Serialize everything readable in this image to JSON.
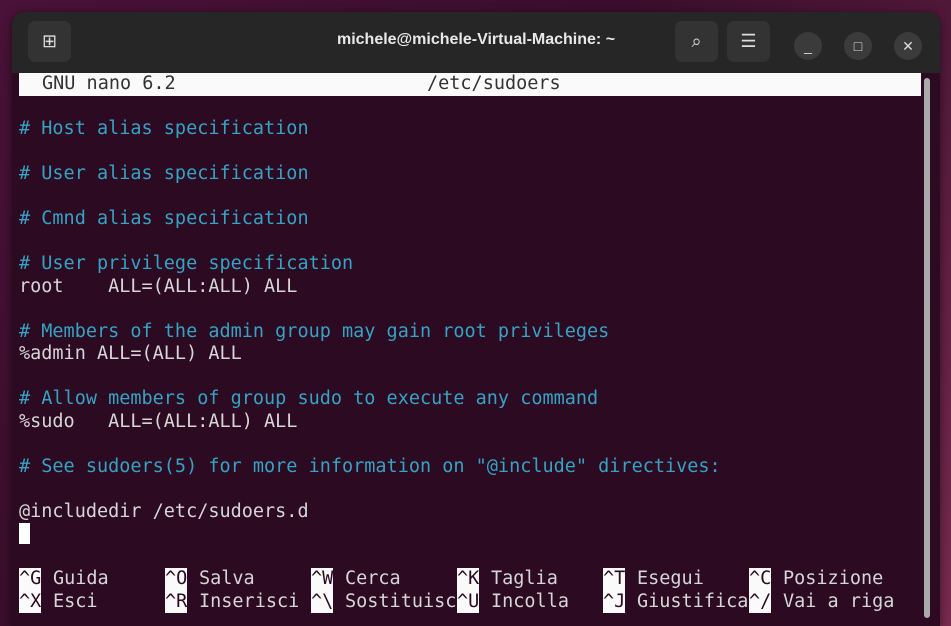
{
  "window": {
    "title": "michele@michele-Virtual-Machine: ~"
  },
  "nano": {
    "version": "GNU nano 6.2",
    "file": "/etc/sudoers"
  },
  "lines": [
    {
      "text": "",
      "type": "text"
    },
    {
      "text": "# Host alias specification",
      "type": "comment"
    },
    {
      "text": "",
      "type": "text"
    },
    {
      "text": "# User alias specification",
      "type": "comment"
    },
    {
      "text": "",
      "type": "text"
    },
    {
      "text": "# Cmnd alias specification",
      "type": "comment"
    },
    {
      "text": "",
      "type": "text"
    },
    {
      "text": "# User privilege specification",
      "type": "comment"
    },
    {
      "text": "root    ALL=(ALL:ALL) ALL",
      "type": "text"
    },
    {
      "text": "",
      "type": "text"
    },
    {
      "text": "# Members of the admin group may gain root privileges",
      "type": "comment"
    },
    {
      "text": "%admin ALL=(ALL) ALL",
      "type": "text"
    },
    {
      "text": "",
      "type": "text"
    },
    {
      "text": "# Allow members of group sudo to execute any command",
      "type": "comment"
    },
    {
      "text": "%sudo   ALL=(ALL:ALL) ALL",
      "type": "text"
    },
    {
      "text": "",
      "type": "text"
    },
    {
      "text": "# See sudoers(5) for more information on \"@include\" directives:",
      "type": "comment"
    },
    {
      "text": "",
      "type": "text"
    },
    {
      "text": "@includedir /etc/sudoers.d",
      "type": "text"
    }
  ],
  "shortcuts": [
    [
      {
        "key": "^G",
        "label": "Guida"
      },
      {
        "key": "^O",
        "label": "Salva"
      },
      {
        "key": "^W",
        "label": "Cerca"
      },
      {
        "key": "^K",
        "label": "Taglia"
      },
      {
        "key": "^T",
        "label": "Esegui"
      },
      {
        "key": "^C",
        "label": "Posizione"
      }
    ],
    [
      {
        "key": "^X",
        "label": "Esci"
      },
      {
        "key": "^R",
        "label": "Inserisci"
      },
      {
        "key": "^\\",
        "label": "Sostituisc"
      },
      {
        "key": "^U",
        "label": "Incolla"
      },
      {
        "key": "^J",
        "label": "Giustifica"
      },
      {
        "key": "^/",
        "label": "Vai a riga"
      }
    ]
  ]
}
